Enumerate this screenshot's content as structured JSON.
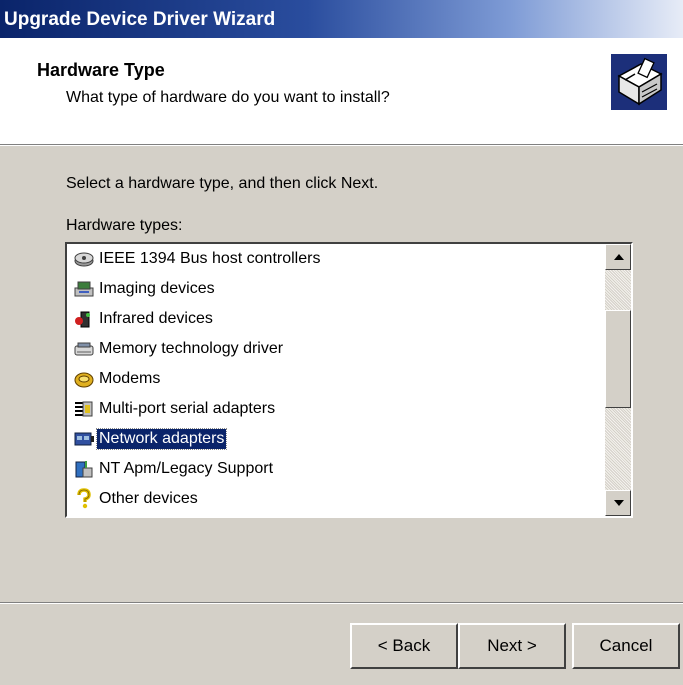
{
  "window": {
    "title": "Upgrade Device Driver Wizard"
  },
  "header": {
    "title": "Hardware Type",
    "subtitle": "What type of hardware do you want to install?",
    "icon": "hardware-wizard-icon"
  },
  "body": {
    "instruction": "Select a hardware type, and then click Next.",
    "list_label": "Hardware types:"
  },
  "hardware_types": {
    "selected_index": 6,
    "items": [
      {
        "label": "IEEE 1394 Bus host controllers",
        "icon": "ieee1394-icon"
      },
      {
        "label": "Imaging devices",
        "icon": "imaging-device-icon"
      },
      {
        "label": "Infrared devices",
        "icon": "infrared-device-icon"
      },
      {
        "label": "Memory technology driver",
        "icon": "memory-tech-icon"
      },
      {
        "label": "Modems",
        "icon": "modem-icon"
      },
      {
        "label": "Multi-port serial adapters",
        "icon": "serial-adapter-icon"
      },
      {
        "label": "Network adapters",
        "icon": "network-adapter-icon"
      },
      {
        "label": "NT Apm/Legacy Support",
        "icon": "legacy-support-icon"
      },
      {
        "label": "Other devices",
        "icon": "question-mark-icon"
      }
    ],
    "scroll_position": 0.35
  },
  "buttons": {
    "back": "< Back",
    "next": "Next >",
    "cancel": "Cancel"
  },
  "colors": {
    "titlebar_start": "#0a246a",
    "titlebar_end": "#e7ecf7",
    "dialog_face": "#d4d0c8",
    "selection": "#0a246a"
  }
}
